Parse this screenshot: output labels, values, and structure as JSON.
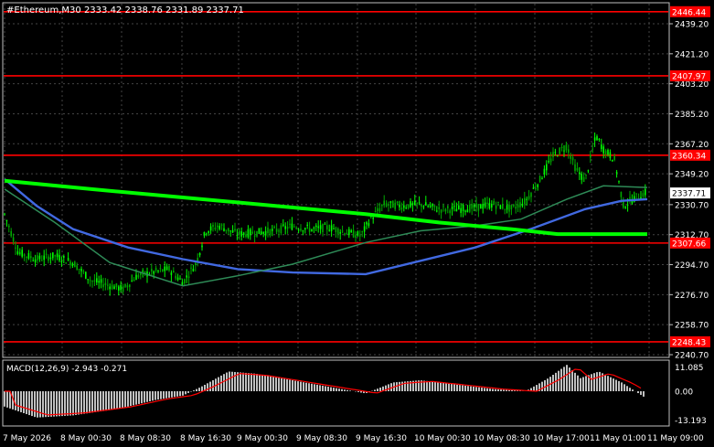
{
  "header": {
    "symbol_line": "#Ethereum,M30  2333.42 2338.76 2331.89 2337.71"
  },
  "price_axis": {
    "ticks": [
      "2439.20",
      "2421.20",
      "2403.20",
      "2385.20",
      "2367.20",
      "2349.20",
      "2330.70",
      "2312.70",
      "2294.70",
      "2276.70",
      "2258.70",
      "2240.70"
    ],
    "tick_values": [
      2439.2,
      2421.2,
      2403.2,
      2385.2,
      2367.2,
      2349.2,
      2330.7,
      2312.7,
      2294.7,
      2276.7,
      2258.7,
      2240.7
    ],
    "current_price_label": "2337.71"
  },
  "levels": [
    {
      "label": "2446.44",
      "value": 2446.44
    },
    {
      "label": "2407.97",
      "value": 2407.97
    },
    {
      "label": "2360.34",
      "value": 2360.34
    },
    {
      "label": "2307.66",
      "value": 2307.66
    },
    {
      "label": "2248.43",
      "value": 2248.43
    }
  ],
  "macd": {
    "label": "MACD(12,26,9) -2.943 -0.271",
    "ticks": [
      "11.085",
      "0.00",
      "-13.193"
    ]
  },
  "time_axis": {
    "labels": [
      "7 May 2026",
      "8 May 00:30",
      "8 May 08:30",
      "8 May 16:30",
      "9 May 00:30",
      "9 May 08:30",
      "9 May 16:30",
      "10 May 00:30",
      "10 May 08:30",
      "10 May 17:00",
      "11 May 01:00",
      "11 May 09:00"
    ]
  },
  "colors": {
    "background": "#000000",
    "bull_candle": "#00ff00",
    "level_line": "#ff0000",
    "ma_green": "#00ff00",
    "ma_blue": "#4169e1",
    "ma_teal": "#2e8b57",
    "macd_hist": "#c0c0c0",
    "macd_signal": "#ff0000",
    "axis_text": "#ffffff"
  }
}
